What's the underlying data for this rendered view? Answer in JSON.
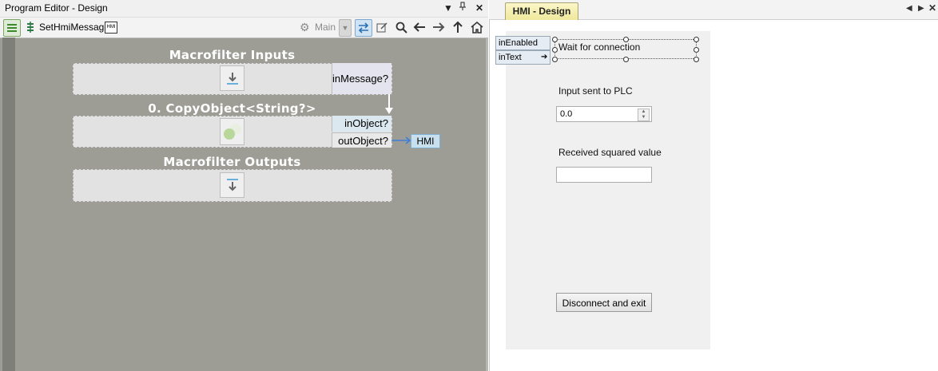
{
  "left": {
    "title": "Program Editor - Design",
    "controls": {
      "dropdown": "▼",
      "pin": "📌",
      "close": "✕"
    },
    "toolbar": {
      "macro_name": "SetHmiMessage",
      "hmi_badge": "HMI",
      "worker": "Main"
    },
    "sections": {
      "inputs_title": "Macrofilter Inputs",
      "copy_title": "0. CopyObject<String?>",
      "outputs_title": "Macrofilter Outputs"
    },
    "ports": {
      "in_message": "inMessage?",
      "in_object": "inObject?",
      "out_object": "outObject?",
      "hmi_target": "HMI"
    }
  },
  "right": {
    "tab_label": "HMI - Design",
    "nav": {
      "prev": "◀",
      "next": "▶",
      "close": "✕"
    },
    "pins": {
      "in_enabled": "inEnabled",
      "in_text": "inText"
    },
    "status_label": "Wait for connection",
    "input_label": "Input sent to PLC",
    "input_value": "0.0",
    "received_label": "Received squared value",
    "received_value": "",
    "disconnect_button": "Disconnect and exit"
  },
  "colors": {
    "canvas": "#9d9d96",
    "block": "#e2e2e2",
    "port": "#dfe6ee",
    "hmi_tab": "#efe89c",
    "link": "#3d7fd8"
  }
}
